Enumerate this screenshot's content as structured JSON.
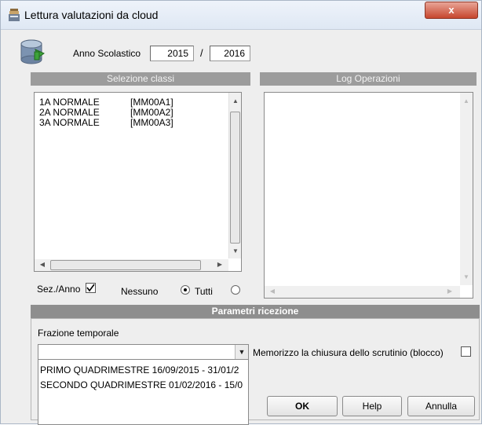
{
  "window": {
    "title": "Lettura valutazioni da cloud",
    "close_label": "x"
  },
  "year": {
    "label": "Anno Scolastico",
    "start": "2015",
    "separator": "/",
    "end": "2016"
  },
  "classes_panel": {
    "header": "Selezione classi",
    "items": [
      {
        "name": "1A NORMALE",
        "code": "[MM00A1]"
      },
      {
        "name": "2A NORMALE",
        "code": "[MM00A2]"
      },
      {
        "name": "3A NORMALE",
        "code": "[MM00A3]"
      }
    ],
    "sez_anno_label": "Sez./Anno",
    "sez_anno_checked": true,
    "nessuno_label": "Nessuno",
    "tutti_label": "Tutti",
    "selected_option": "Tutti"
  },
  "log_panel": {
    "header": "Log Operazioni"
  },
  "params": {
    "header": "Parametri ricezione",
    "frazione_label": "Frazione temporale",
    "combo_value": "",
    "options": [
      "PRIMO QUADRIMESTRE 16/09/2015 - 31/01/2",
      "SECONDO QUADRIMESTRE 01/02/2016 - 15/0"
    ],
    "memorizzo_label": "Memorizzo la chiusura dello scrutinio (blocco)",
    "memorizzo_checked": false
  },
  "buttons": {
    "ok": "OK",
    "help": "Help",
    "annulla": "Annulla"
  }
}
